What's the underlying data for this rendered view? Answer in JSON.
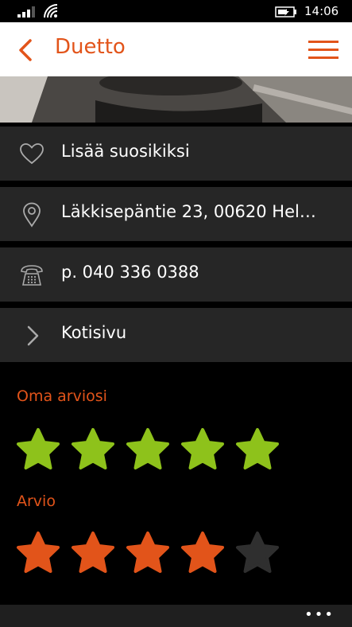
{
  "status": {
    "time": "14:06"
  },
  "appbar": {
    "title": "Duetto"
  },
  "rows": {
    "favorite": "Lisää suosikiksi",
    "address": "Läkkisepäntie 23, 00620 Hel…",
    "phone": "p. 040 336 0388",
    "website": "Kotisivu"
  },
  "own_rating": {
    "label": "Oma arviosi",
    "value": 5,
    "max": 5,
    "color": "#8ec21b"
  },
  "rating": {
    "label": "Arvio",
    "value": 4,
    "max": 5,
    "color": "#e2541a",
    "empty_color": "#2f2f2f"
  }
}
